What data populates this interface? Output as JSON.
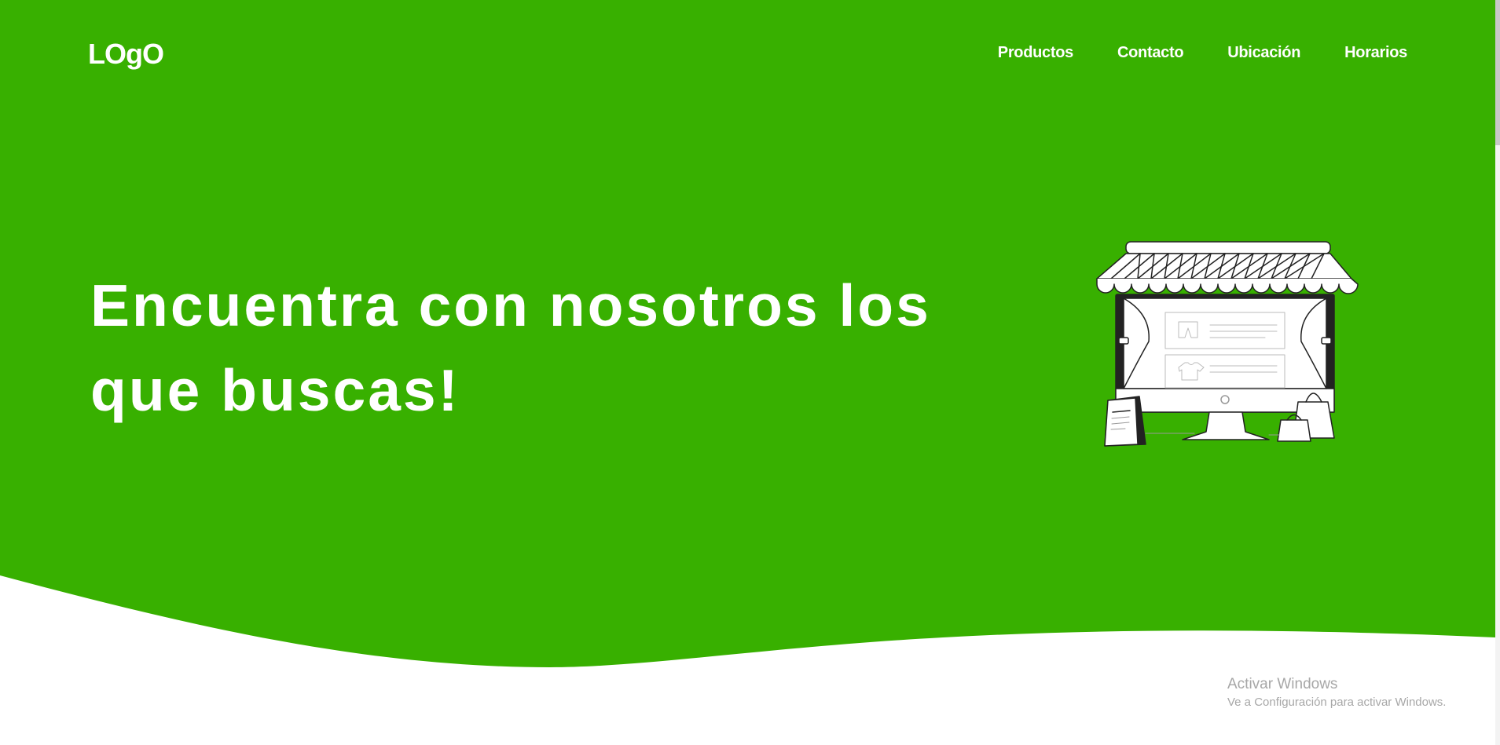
{
  "header": {
    "logo": "LOgO",
    "nav": [
      {
        "label": "Productos"
      },
      {
        "label": "Contacto"
      },
      {
        "label": "Ubicación"
      },
      {
        "label": "Horarios"
      }
    ]
  },
  "hero": {
    "headline_line1": "Encuentra con nosotros los",
    "headline_line2": "que buscas!",
    "illustration_icon": "storefront-icon"
  },
  "watermark": {
    "title": "Activar Windows",
    "subtitle": "Ve a Configuración para activar Windows."
  },
  "colors": {
    "brand_green": "#38b000",
    "background": "#ffffff",
    "text_on_brand": "#ffffff"
  }
}
